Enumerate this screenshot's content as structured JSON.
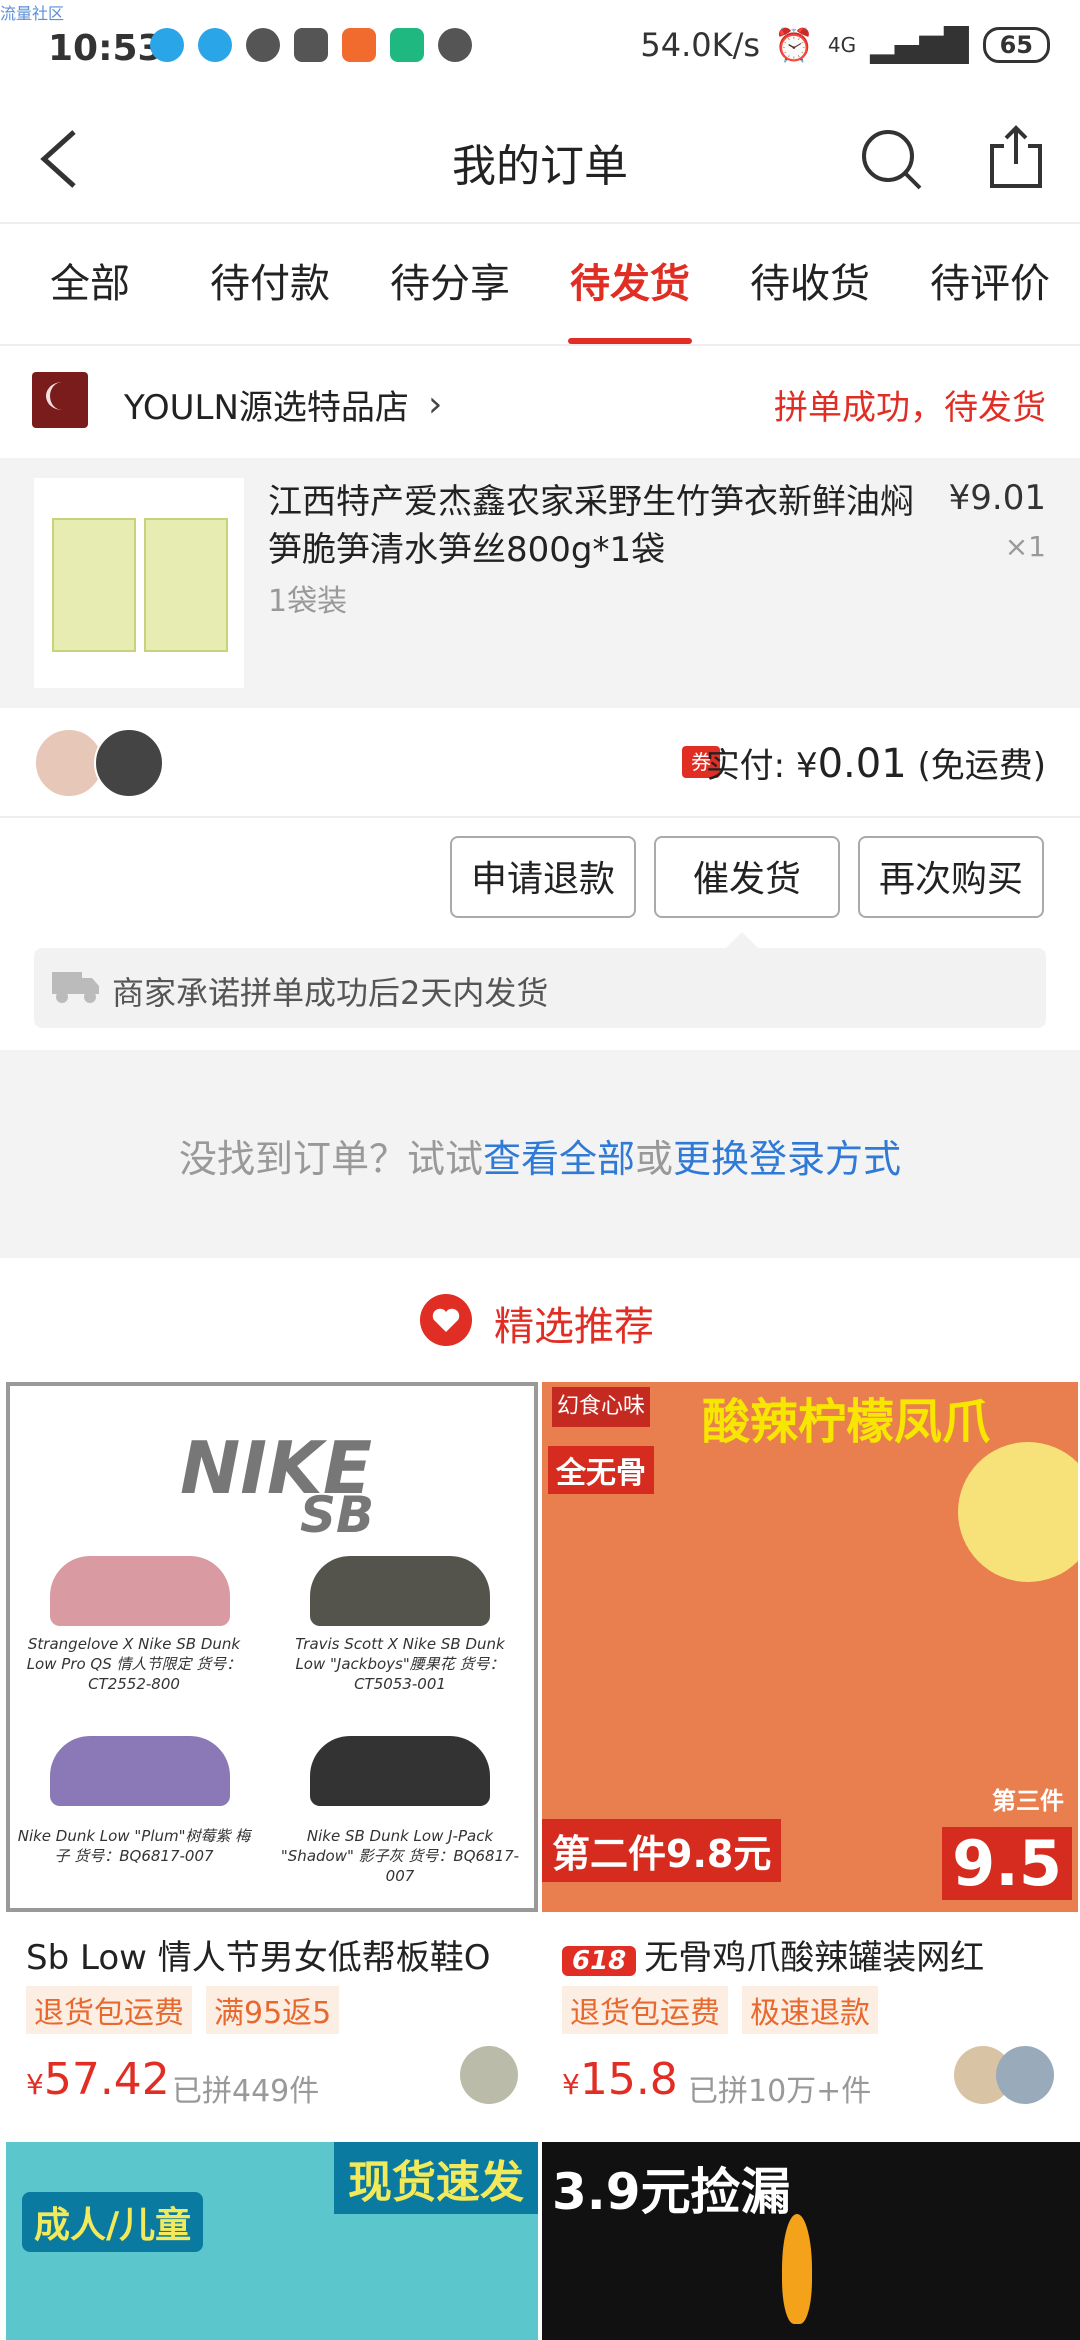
{
  "watermark": "流量社区",
  "status_bar": {
    "time": "10:53",
    "speed": "54.0K/s",
    "network": "4G",
    "battery": "65"
  },
  "nav": {
    "title": "我的订单"
  },
  "tabs": [
    {
      "label": "全部"
    },
    {
      "label": "待付款"
    },
    {
      "label": "待分享"
    },
    {
      "label": "待发货"
    },
    {
      "label": "待收货"
    },
    {
      "label": "待评价"
    }
  ],
  "order": {
    "store_name": "YOULN源选特品店",
    "status": "拼单成功，待发货",
    "product_name": "江西特产爱杰鑫农家采野生竹笋衣新鲜油焖笋脆笋清水笋丝800g*1袋",
    "spec": "1袋装",
    "price": "¥9.01",
    "qty": "×1",
    "coupon": "券",
    "paid_label": "实付: ¥",
    "paid_amount": "0.01",
    "shipping_note": "(免运费)",
    "buttons": {
      "refund": "申请退款",
      "urge": "催发货",
      "rebuy": "再次购买"
    },
    "tip": "商家承诺拼单成功后2天内发货"
  },
  "notfound": {
    "prefix": "没找到订单？试试",
    "link1": "查看全部",
    "mid": "或",
    "link2": "更换登录方式"
  },
  "recommend": {
    "title": "精选推荐"
  },
  "cards": [
    {
      "title": "Sb Low 情人节男女低帮板鞋O",
      "tags": [
        "退货包运费",
        "满95返5"
      ],
      "price_symbol": "¥",
      "price": "57.42",
      "sold": "已拼449件",
      "image": {
        "brand": "NIKE",
        "sub": "SB",
        "cap1": "Strangelove X Nike SB Dunk Low Pro QS 情人节限定 货号：CT2552-800",
        "cap2": "Travis Scott X Nike SB Dunk Low \"Jackboys\"腰果花 货号：CT5053-001",
        "cap3": "Nike Dunk Low \"Plum\"树莓紫 梅子 货号：BQ6817-007",
        "cap4": "Nike SB Dunk Low J-Pack \"Shadow\" 影子灰 货号：BQ6817-007"
      }
    },
    {
      "badge": "618",
      "title": "无骨鸡爪酸辣罐装网红",
      "tags": [
        "退货包运费",
        "极速退款"
      ],
      "price_symbol": "¥",
      "price": "15.8",
      "sold": "已拼10万+件",
      "image": {
        "brand": "幻食心味",
        "headline": "酸辣柠檬凤爪",
        "boneless": "全无骨",
        "deal2": "第二件9.8元",
        "deal3_label": "第三件",
        "deal3": "9.5"
      }
    }
  ],
  "bottom_cards": [
    {
      "banner": "现货速发",
      "tag": "成人/儿童"
    },
    {
      "text": "3.9元捡漏"
    }
  ]
}
